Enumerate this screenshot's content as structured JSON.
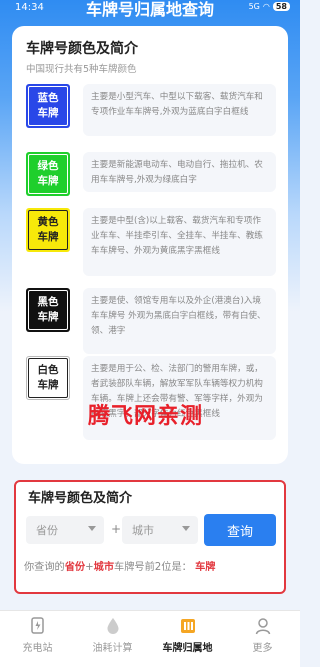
{
  "status_bar": {
    "time": "14:34",
    "battery": "58",
    "network": "5G"
  },
  "header": {
    "title": "车牌号归属地查询"
  },
  "colors_section": {
    "title": "车牌号颜色及简介",
    "subtitle": "中国现行共有5种车牌颜色",
    "plates": [
      {
        "label": "蓝色\n车牌",
        "bg": "#2947e8",
        "fg": "#ffffff",
        "desc": "主要是小型汽车、中型以下载客、载货汽车和专项作业车车牌号,外观为蓝底白字白框线"
      },
      {
        "label": "绿色\n车牌",
        "bg": "#1fcf2c",
        "fg": "#ffffff",
        "desc": "主要是新能源电动车、电动自行、拖拉机、农用车车牌号,外观为绿底白字"
      },
      {
        "label": "黄色\n车牌",
        "bg": "#f7e90a",
        "fg": "#222222",
        "desc": "主要是中型(含)以上载客、载货汽车和专项作业车车、半挂牵引车、全挂车、半挂车、教练车车牌号、外观为黄底黑字黑框线"
      },
      {
        "label": "黑色\n车牌",
        "bg": "#111111",
        "fg": "#ffffff",
        "desc": "主要是使、领馆专用车以及外企(港澳台)入境车车牌号 外观为黑底白字白框线，带有白使、领、港字"
      },
      {
        "label": "白色\n车牌",
        "bg": "#ffffff",
        "fg": "#222222",
        "desc": "主要是用于公、检、法部门的警用车牌，或，者武装部队车辆，解放军军队车辆等权力机构车辆。车牌上还会带有警、军等字样，外观为白底黑字，部分字体为红色黑框线"
      }
    ]
  },
  "watermark": "腾飞网亲测",
  "query_section": {
    "title": "车牌号颜色及简介",
    "province_placeholder": "省份",
    "city_placeholder": "城市",
    "plus": "+",
    "query_button": "查询",
    "result_prefix": "你查询的",
    "result_province": "省份",
    "result_plus": "+",
    "result_city": "城市",
    "result_mid": "车牌号前2位是：",
    "result_value": "车牌"
  },
  "tabbar": {
    "items": [
      {
        "label": "充电站",
        "icon": "charging-station-icon"
      },
      {
        "label": "油耗计算",
        "icon": "fuel-drop-icon"
      },
      {
        "label": "车牌归属地",
        "icon": "license-plate-icon",
        "active": true
      },
      {
        "label": "更多",
        "icon": "user-icon"
      }
    ]
  }
}
